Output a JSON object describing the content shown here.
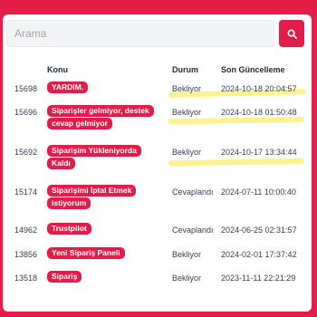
{
  "search": {
    "placeholder": "Arama"
  },
  "table": {
    "headers": {
      "subject": "Konu",
      "status": "Durum",
      "updated": "Son Güncelleme"
    },
    "rows": [
      {
        "id": "15698",
        "subject": [
          "YARDIM."
        ],
        "status": "Bekliyor",
        "updated": "2024-10-18 20:04:57"
      },
      {
        "id": "15696",
        "subject": [
          "Siparişler gelmiyor, destek",
          "cevap gelmiyor"
        ],
        "status": "Bekliyor",
        "updated": "2024-10-18 01:50:48"
      },
      {
        "id": "15692",
        "subject": [
          "Siparişim Yükleniyorda",
          "Kaldı"
        ],
        "status": "Bekliyor",
        "updated": "2024-10-17 13:34:44"
      },
      {
        "id": "15174",
        "subject": [
          "Siparişimi İptal Etmek",
          "istiyorum"
        ],
        "status": "Cevaplandı",
        "updated": "2024-07-11 10:00:40"
      },
      {
        "id": "14962",
        "subject": [
          "Trustpilot"
        ],
        "status": "Cevaplandı",
        "updated": "2024-06-25 02:31:57"
      },
      {
        "id": "13856",
        "subject": [
          "Yeni Sipariş Paneli"
        ],
        "status": "Bekliyor",
        "updated": "2024-02-01 17:37:42"
      },
      {
        "id": "13518",
        "subject": [
          "Sipariş"
        ],
        "status": "Bekliyor",
        "updated": "2023-11-11 22:21:29"
      }
    ]
  },
  "colors": {
    "accent": "#e11d48",
    "highlight": "#fef08a"
  },
  "icons": {
    "search_button": "search-icon"
  }
}
